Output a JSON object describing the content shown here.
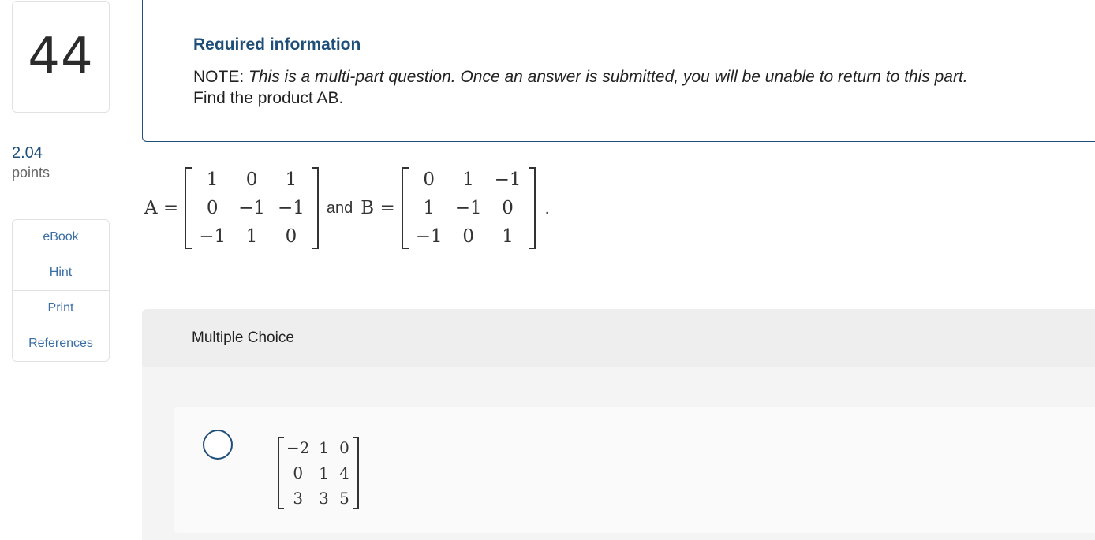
{
  "sidebar": {
    "question_number": "44",
    "points_value": "2.04",
    "points_label": "points",
    "tools": [
      "eBook",
      "Hint",
      "Print",
      "References"
    ]
  },
  "info": {
    "title": "Required information",
    "note_prefix": "NOTE:",
    "note_text": "This is a multi-part question. Once an answer is submitted, you will be unable to return to this part.",
    "prompt": "Find the product AB."
  },
  "equation": {
    "a_label": "A =",
    "matrix_a": [
      "1",
      "0",
      "1",
      "0",
      "−1",
      "−1",
      "−1",
      "1",
      "0"
    ],
    "and_text": "and",
    "b_label": "B =",
    "matrix_b": [
      "0",
      "1",
      "−1",
      "1",
      "−1",
      "0",
      "−1",
      "0",
      "1"
    ],
    "period": "."
  },
  "multiple_choice": {
    "header": "Multiple Choice",
    "option_1_matrix": [
      "−2",
      "1",
      "0",
      "0",
      "1",
      "4",
      "3",
      "3",
      "5"
    ]
  },
  "colors": {
    "accent": "#1f4e79",
    "link": "#3a6ea5",
    "panel_gray": "#eeeeee"
  }
}
